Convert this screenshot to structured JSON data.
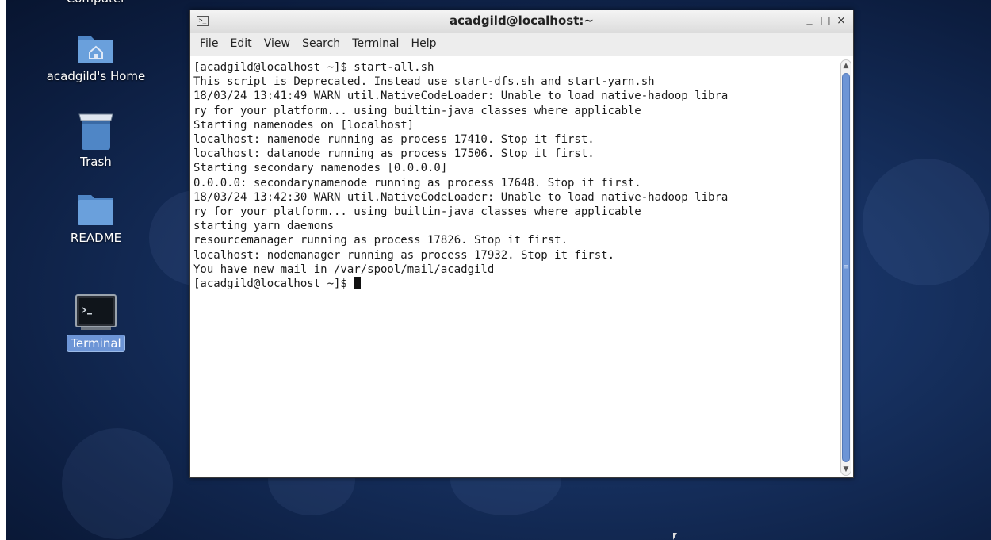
{
  "desktop": {
    "icons": [
      {
        "label": "Computer"
      },
      {
        "label": "acadgild's Home"
      },
      {
        "label": "Trash"
      },
      {
        "label": "README"
      },
      {
        "label": "Terminal",
        "selected": true
      }
    ]
  },
  "window": {
    "title": "acadgild@localhost:~",
    "controls": {
      "minimize": "_",
      "maximize": "□",
      "close": "×"
    },
    "menu": [
      "File",
      "Edit",
      "View",
      "Search",
      "Terminal",
      "Help"
    ],
    "terminal_lines": [
      "[acadgild@localhost ~]$ start-all.sh",
      "This script is Deprecated. Instead use start-dfs.sh and start-yarn.sh",
      "18/03/24 13:41:49 WARN util.NativeCodeLoader: Unable to load native-hadoop libra",
      "ry for your platform... using builtin-java classes where applicable",
      "Starting namenodes on [localhost]",
      "localhost: namenode running as process 17410. Stop it first.",
      "localhost: datanode running as process 17506. Stop it first.",
      "Starting secondary namenodes [0.0.0.0]",
      "0.0.0.0: secondarynamenode running as process 17648. Stop it first.",
      "18/03/24 13:42:30 WARN util.NativeCodeLoader: Unable to load native-hadoop libra",
      "ry for your platform... using builtin-java classes where applicable",
      "starting yarn daemons",
      "resourcemanager running as process 17826. Stop it first.",
      "localhost: nodemanager running as process 17932. Stop it first.",
      "You have new mail in /var/spool/mail/acadgild"
    ],
    "prompt": "[acadgild@localhost ~]$ "
  },
  "colors": {
    "desktop_bg": "#16305f",
    "selection": "#6d95d6",
    "folder": "#5d90cc"
  }
}
